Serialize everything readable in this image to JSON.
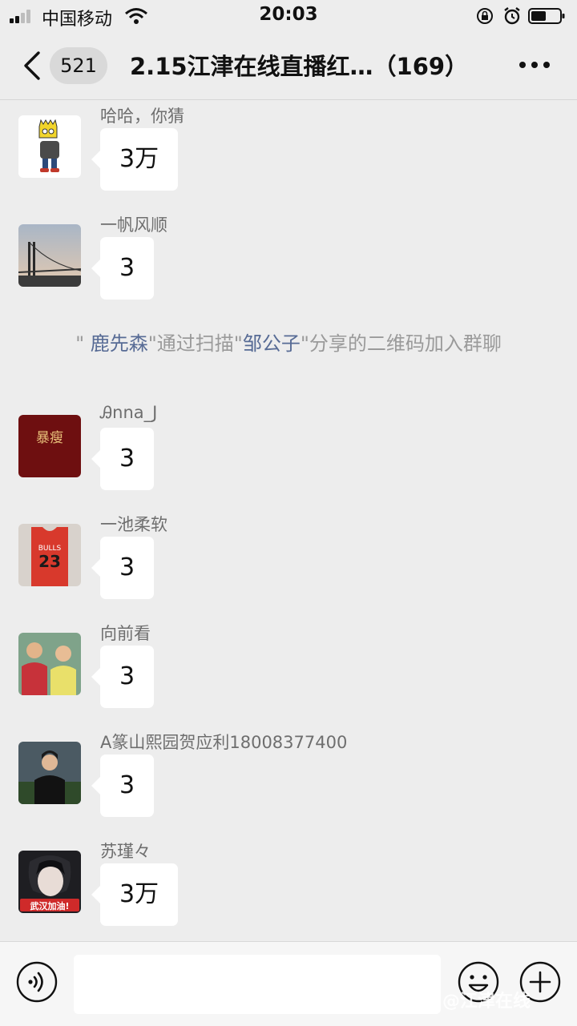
{
  "status_bar": {
    "carrier": "中国移动",
    "time": "20:03",
    "icons": [
      "signal-icon",
      "wifi-icon",
      "rotation-lock-icon",
      "alarm-icon",
      "battery-icon"
    ]
  },
  "nav": {
    "unread_count": "521",
    "title": "2.15江津在线直播红…（169）",
    "icons": [
      "back-icon",
      "more-icon"
    ]
  },
  "messages": [
    {
      "sender": "哈哈，你猜",
      "text": "3万",
      "avatar": "bart-simpson-avatar"
    },
    {
      "sender": "一帆风顺",
      "text": "3",
      "avatar": "bridge-sunset-avatar"
    }
  ],
  "system_notice": {
    "quote_open": "\" ",
    "inviter": "鹿先森",
    "middle": "\"通过扫描\"",
    "sharer": "邹公子",
    "suffix": "\"分享的二维码加入群聊"
  },
  "messages_after": [
    {
      "sender": "Ꭿnna_J",
      "text": "3",
      "avatar": "red-book-avatar",
      "avatar_text": "暴瘦"
    },
    {
      "sender": "一池柔软",
      "text": "3",
      "avatar": "bulls-jersey-avatar",
      "avatar_text": "23"
    },
    {
      "sender": "向前看",
      "text": "3",
      "avatar": "kids-photo-avatar"
    },
    {
      "sender": "A篆山熙园贺应利18008377400",
      "text": "3",
      "avatar": "person-portrait-avatar"
    },
    {
      "sender": "苏瑾々",
      "text": "3万",
      "avatar": "anime-avatar",
      "avatar_text": "武汉加油!"
    }
  ],
  "input_bar": {
    "placeholder": "",
    "icons": [
      "voice-icon",
      "emoji-icon",
      "add-icon"
    ]
  },
  "watermark": "@江津在线",
  "colors": {
    "background": "#ededed",
    "link": "#576b95",
    "bubble": "#ffffff",
    "system_text": "#9a9a9a"
  }
}
